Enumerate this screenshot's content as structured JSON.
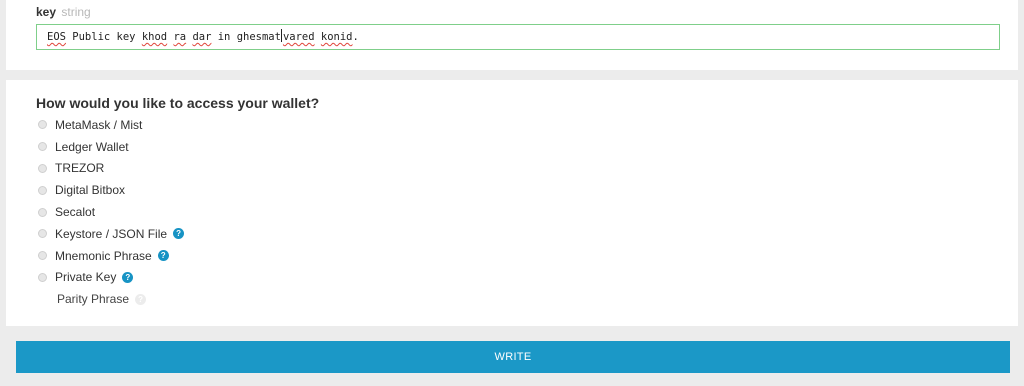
{
  "field": {
    "name": "key",
    "type": "string",
    "value_parts": [
      "EOS",
      " Public key ",
      "khod",
      " ",
      "ra",
      " ",
      "dar",
      " in ghesmat",
      "vared",
      " ",
      "konid",
      "."
    ]
  },
  "wallet": {
    "heading": "How would you like to access your wallet?",
    "options": [
      {
        "label": "MetaMask / Mist",
        "help": ""
      },
      {
        "label": "Ledger Wallet",
        "help": ""
      },
      {
        "label": "TREZOR",
        "help": ""
      },
      {
        "label": "Digital Bitbox",
        "help": ""
      },
      {
        "label": "Secalot",
        "help": ""
      },
      {
        "label": "Keystore / JSON File",
        "help": "?"
      },
      {
        "label": "Mnemonic Phrase",
        "help": "?"
      },
      {
        "label": "Private Key",
        "help": "?"
      }
    ],
    "sub_option": {
      "label": "Parity Phrase",
      "help": "?"
    }
  },
  "actions": {
    "write_label": "WRITE"
  },
  "colors": {
    "accent": "#1b98c7",
    "input_border": "#7fcf8a",
    "help_icon": "#1793c4",
    "spellcheck": "#e0443a"
  }
}
